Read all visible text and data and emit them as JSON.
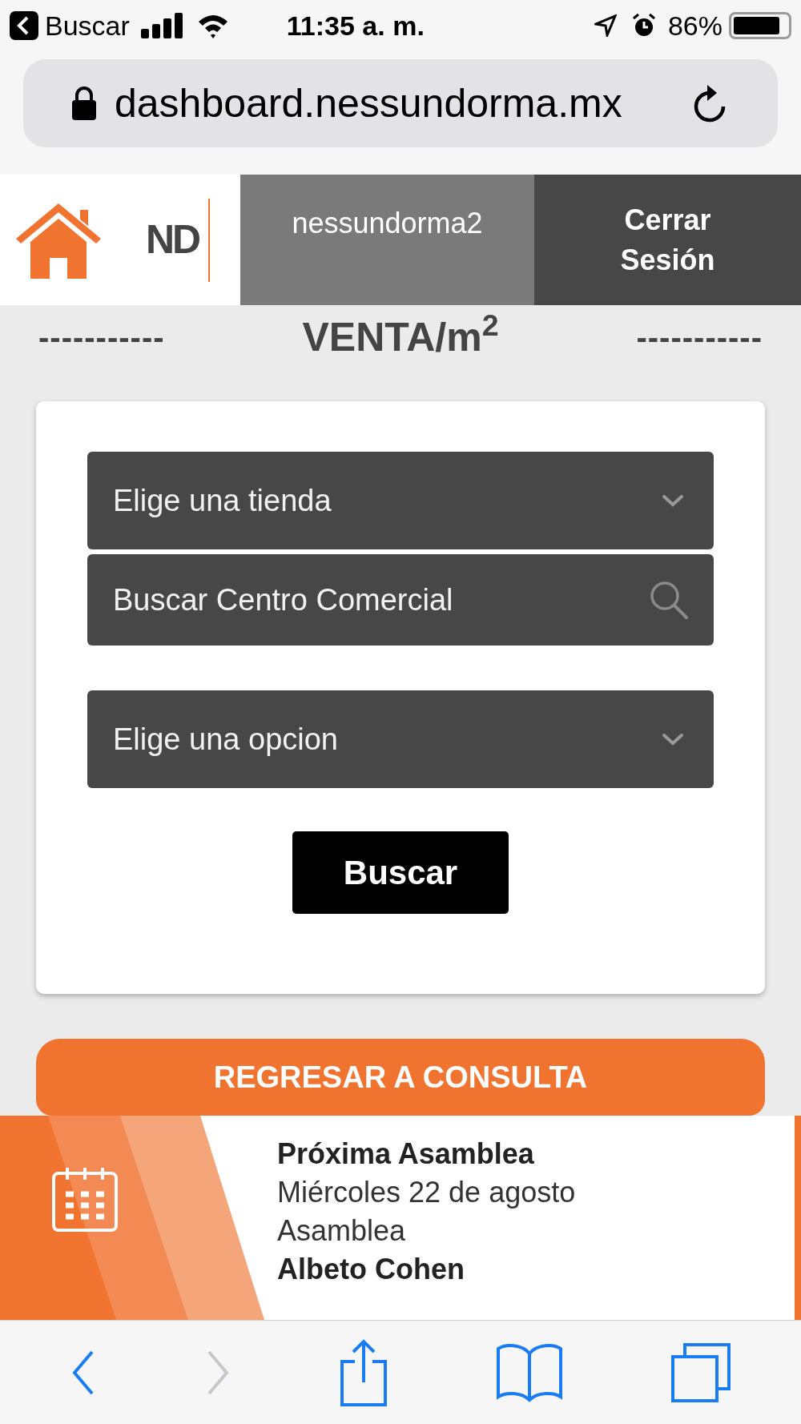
{
  "status_bar": {
    "back_app": "Buscar",
    "time": "11:35 a. m.",
    "battery": "86%"
  },
  "address_bar": {
    "url": "dashboard.nessundorma.mx"
  },
  "header": {
    "logo": "ND",
    "username": "nessundorma2",
    "logout": "Cerrar Sesión"
  },
  "title": {
    "left_rule": "-----------",
    "text": "VENTA/m$^{2}$",
    "right_rule": "-----------"
  },
  "form": {
    "fields": [
      {
        "kind": "dropdown",
        "placeholder": "Elige una tienda"
      },
      {
        "kind": "search",
        "placeholder": "Buscar Centro Comercial"
      },
      {
        "kind": "dropdown",
        "placeholder": "Elige una opcion"
      }
    ],
    "submit": "Buscar"
  },
  "back_button": "REGRESAR A CONSULTA",
  "event": {
    "title": "Próxima Asamblea",
    "date": "Miércoles 22 de agosto",
    "type": "Asamblea",
    "person": "Albeto Cohen"
  },
  "toolbar": [
    {
      "kind": "back",
      "disabled": false
    },
    {
      "kind": "forward",
      "disabled": true
    },
    {
      "kind": "share",
      "disabled": false
    },
    {
      "kind": "bookmarks",
      "disabled": false
    },
    {
      "kind": "tabs",
      "disabled": false
    }
  ]
}
